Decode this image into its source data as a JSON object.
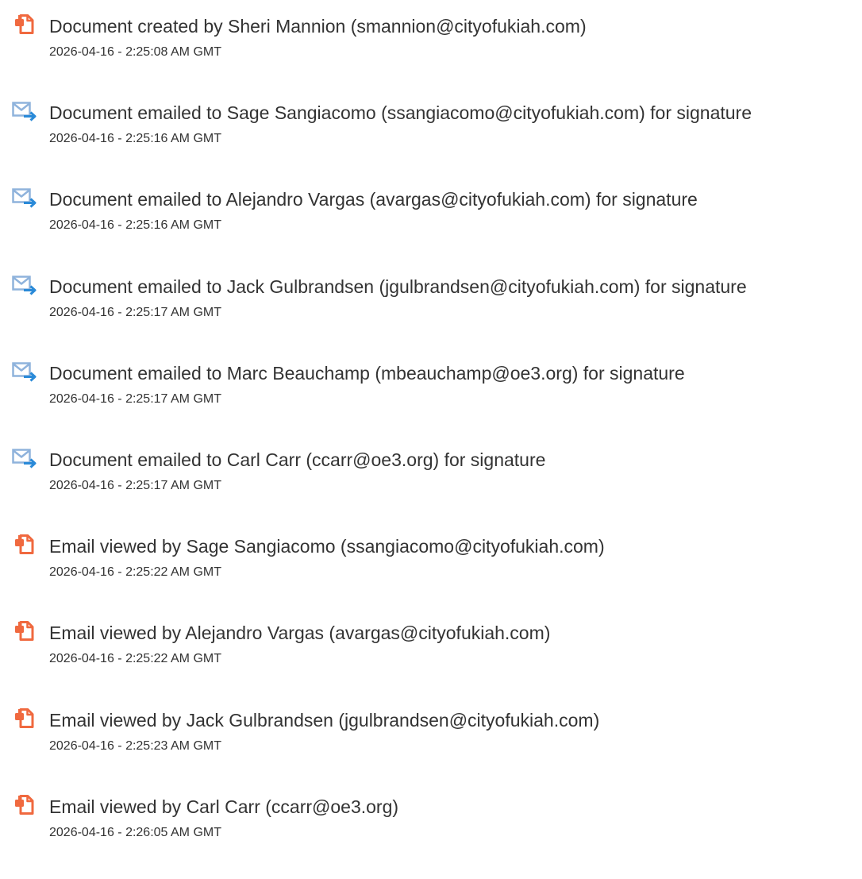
{
  "entries": [
    {
      "icon": "document-icon",
      "description": "Document created by Sheri Mannion (smannion@cityofukiah.com)",
      "timestamp": "2026-04-16 - 2:25:08 AM GMT"
    },
    {
      "icon": "email-sent-icon",
      "description": "Document emailed to Sage Sangiacomo (ssangiacomo@cityofukiah.com) for signature",
      "timestamp": "2026-04-16 - 2:25:16 AM GMT"
    },
    {
      "icon": "email-sent-icon",
      "description": "Document emailed to Alejandro Vargas (avargas@cityofukiah.com) for signature",
      "timestamp": "2026-04-16 - 2:25:16 AM GMT"
    },
    {
      "icon": "email-sent-icon",
      "description": "Document emailed to Jack Gulbrandsen (jgulbrandsen@cityofukiah.com) for signature",
      "timestamp": "2026-04-16 - 2:25:17 AM GMT"
    },
    {
      "icon": "email-sent-icon",
      "description": "Document emailed to Marc Beauchamp (mbeauchamp@oe3.org) for signature",
      "timestamp": "2026-04-16 - 2:25:17 AM GMT"
    },
    {
      "icon": "email-sent-icon",
      "description": "Document emailed to Carl Carr (ccarr@oe3.org) for signature",
      "timestamp": "2026-04-16 - 2:25:17 AM GMT"
    },
    {
      "icon": "document-icon",
      "description": "Email viewed by Sage Sangiacomo (ssangiacomo@cityofukiah.com)",
      "timestamp": "2026-04-16 - 2:25:22 AM GMT"
    },
    {
      "icon": "document-icon",
      "description": "Email viewed by Alejandro Vargas (avargas@cityofukiah.com)",
      "timestamp": "2026-04-16 - 2:25:22 AM GMT"
    },
    {
      "icon": "document-icon",
      "description": "Email viewed by Jack Gulbrandsen (jgulbrandsen@cityofukiah.com)",
      "timestamp": "2026-04-16 - 2:25:23 AM GMT"
    },
    {
      "icon": "document-icon",
      "description": "Email viewed by Carl Carr (ccarr@oe3.org)",
      "timestamp": "2026-04-16 - 2:26:05 AM GMT"
    }
  ],
  "colors": {
    "document_icon": "#f0693f",
    "email_icon_outline": "#8fb3dc",
    "email_icon_arrow": "#2a8ad8",
    "text": "#333333"
  }
}
